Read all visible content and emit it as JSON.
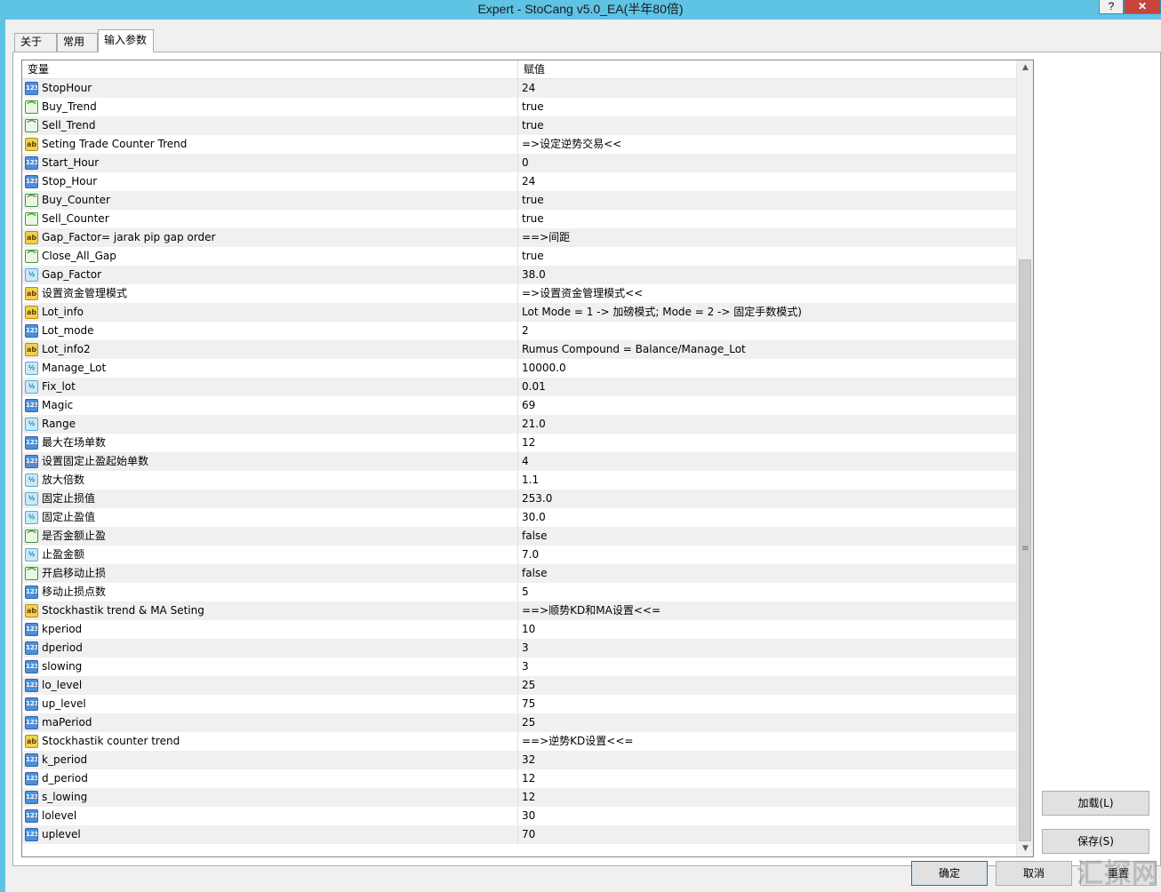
{
  "window": {
    "title": "Expert - StoCang v5.0_EA(半年80倍)",
    "help_label": "?",
    "close_label": "✕"
  },
  "tabs": [
    {
      "label": "关于"
    },
    {
      "label": "常用"
    },
    {
      "label": "输入参数"
    }
  ],
  "grid": {
    "header_variable": "变量",
    "header_value": "赋值",
    "rows": [
      {
        "type": "int",
        "name": "StopHour",
        "value": "24"
      },
      {
        "type": "bool",
        "name": "Buy_Trend",
        "value": "true"
      },
      {
        "type": "bool",
        "name": "Sell_Trend",
        "value": "true"
      },
      {
        "type": "str",
        "name": "Seting Trade Counter Trend",
        "value": "=>设定逆势交易<<"
      },
      {
        "type": "int",
        "name": "Start_Hour",
        "value": "0"
      },
      {
        "type": "int",
        "name": "Stop_Hour",
        "value": "24"
      },
      {
        "type": "bool",
        "name": "Buy_Counter",
        "value": "true"
      },
      {
        "type": "bool",
        "name": "Sell_Counter",
        "value": "true"
      },
      {
        "type": "str",
        "name": "Gap_Factor= jarak pip gap order",
        "value": "==>间距"
      },
      {
        "type": "bool",
        "name": "Close_All_Gap",
        "value": "true"
      },
      {
        "type": "dbl",
        "name": "Gap_Factor",
        "value": "38.0"
      },
      {
        "type": "str",
        "name": "设置资金管理模式",
        "value": "=>设置资金管理模式<<"
      },
      {
        "type": "str",
        "name": "Lot_info",
        "value": "Lot Mode = 1 -> 加磅模式; Mode = 2 -> 固定手数模式)"
      },
      {
        "type": "int",
        "name": "Lot_mode",
        "value": "2"
      },
      {
        "type": "str",
        "name": "Lot_info2",
        "value": "Rumus Compound = Balance/Manage_Lot"
      },
      {
        "type": "dbl",
        "name": "Manage_Lot",
        "value": "10000.0"
      },
      {
        "type": "dbl",
        "name": "Fix_lot",
        "value": "0.01"
      },
      {
        "type": "int",
        "name": "Magic",
        "value": "69"
      },
      {
        "type": "dbl",
        "name": "Range",
        "value": "21.0"
      },
      {
        "type": "int",
        "name": "最大在场单数",
        "value": "12"
      },
      {
        "type": "int",
        "name": "设置固定止盈起始单数",
        "value": "4"
      },
      {
        "type": "dbl",
        "name": "放大倍数",
        "value": "1.1"
      },
      {
        "type": "dbl",
        "name": "固定止损值",
        "value": "253.0"
      },
      {
        "type": "dbl",
        "name": "固定止盈值",
        "value": "30.0"
      },
      {
        "type": "bool",
        "name": "是否金额止盈",
        "value": "false"
      },
      {
        "type": "dbl",
        "name": "止盈金额",
        "value": "7.0"
      },
      {
        "type": "bool",
        "name": "开启移动止损",
        "value": "false"
      },
      {
        "type": "int",
        "name": "移动止损点数",
        "value": "5"
      },
      {
        "type": "str",
        "name": "Stockhastik trend & MA Seting",
        "value": "==>顺势KD和MA设置<<="
      },
      {
        "type": "int",
        "name": "kperiod",
        "value": "10"
      },
      {
        "type": "int",
        "name": "dperiod",
        "value": "3"
      },
      {
        "type": "int",
        "name": "slowing",
        "value": "3"
      },
      {
        "type": "int",
        "name": "lo_level",
        "value": "25"
      },
      {
        "type": "int",
        "name": "up_level",
        "value": "75"
      },
      {
        "type": "int",
        "name": "maPeriod",
        "value": "25"
      },
      {
        "type": "str",
        "name": "Stockhastik counter trend",
        "value": "==>逆势KD设置<<="
      },
      {
        "type": "int",
        "name": "k_period",
        "value": "32"
      },
      {
        "type": "int",
        "name": "d_period",
        "value": "12"
      },
      {
        "type": "int",
        "name": "s_lowing",
        "value": "12"
      },
      {
        "type": "int",
        "name": "lolevel",
        "value": "30"
      },
      {
        "type": "int",
        "name": "uplevel",
        "value": "70"
      }
    ]
  },
  "type_icons": {
    "int": "123",
    "bool": "⌒",
    "str": "ab",
    "dbl": "½"
  },
  "buttons": {
    "load": "加载(L)",
    "save": "保存(S)",
    "ok": "确定",
    "cancel": "取消",
    "reset": "重置"
  },
  "watermark": "汇探网"
}
